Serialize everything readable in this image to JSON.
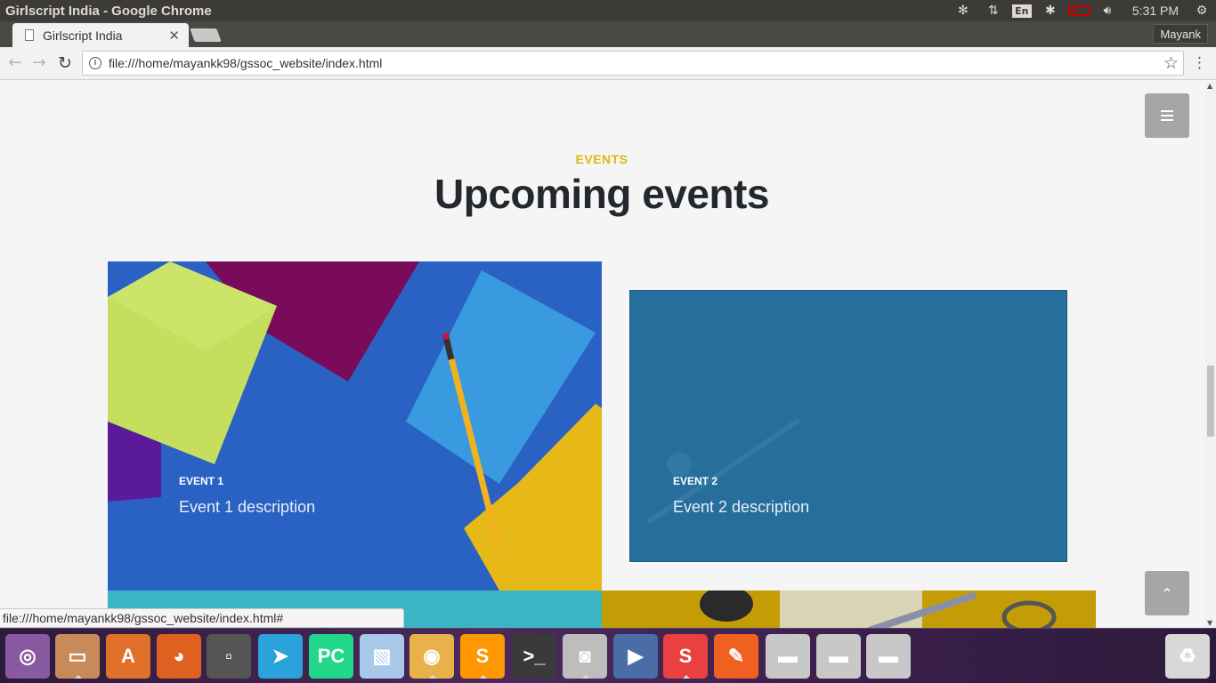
{
  "os": {
    "window_title": "Girlscript India - Google Chrome",
    "keyboard_layout": "En",
    "clock": "5:31 PM"
  },
  "browser": {
    "tab_title": "Girlscript India",
    "profile_name": "Mayank",
    "url": "file:///home/mayankk98/gssoc_website/index.html",
    "status_url": "file:///home/mayankk98/gssoc_website/index.html#"
  },
  "page": {
    "section_eyebrow": "EVENTS",
    "section_title": "Upcoming events",
    "events": [
      {
        "label": "EVENT 1",
        "description": "Event 1 description"
      },
      {
        "label": "EVENT 2",
        "description": "Event 2 description"
      }
    ]
  },
  "colors": {
    "accent": "#e0b70c",
    "title": "#23272e",
    "event2_overlay": "#266e9b"
  },
  "dock": {
    "items": [
      {
        "name": "ubuntu-logo-icon",
        "color": "#8a5aa0"
      },
      {
        "name": "files-icon",
        "color": "#c98a5a"
      },
      {
        "name": "software-center-icon",
        "color": "#e0702a"
      },
      {
        "name": "firefox-icon",
        "color": "#e06020"
      },
      {
        "name": "workspace-switcher-icon",
        "color": "#555"
      },
      {
        "name": "telegram-icon",
        "color": "#2aa3dc"
      },
      {
        "name": "pycharm-icon",
        "color": "#21d789"
      },
      {
        "name": "virtualbox-icon",
        "color": "#a8c8e8"
      },
      {
        "name": "chrome-icon",
        "color": "#e8b24a"
      },
      {
        "name": "sublime-text-icon",
        "color": "#ff9800"
      },
      {
        "name": "terminal-icon",
        "color": "#3a3a3a"
      },
      {
        "name": "screenshot-icon",
        "color": "#bdbdbd"
      },
      {
        "name": "video-editor-icon",
        "color": "#4a6da8"
      },
      {
        "name": "slack-icon",
        "color": "#e8413f"
      },
      {
        "name": "inkscape-icon",
        "color": "#f06020"
      },
      {
        "name": "drive-icon-1",
        "color": "#c8c8c8"
      },
      {
        "name": "drive-icon-2",
        "color": "#c8c8c8"
      },
      {
        "name": "drive-icon-3",
        "color": "#c8c8c8"
      },
      {
        "name": "trash-icon",
        "color": "#d8d8d8"
      }
    ]
  }
}
